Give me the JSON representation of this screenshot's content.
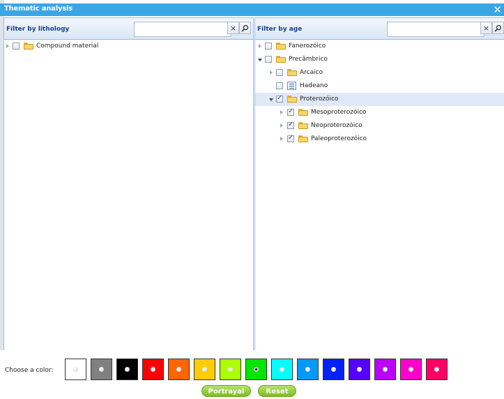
{
  "window": {
    "title": "Thematic analysis",
    "close_symbol": "✕"
  },
  "lithology": {
    "title": "Filter by lithology",
    "search_value": "",
    "clear_symbol": "×",
    "tree": [
      {
        "label": "Compound material",
        "expanded": false,
        "checked": false
      }
    ]
  },
  "age": {
    "title": "Filter by age",
    "search_value": "",
    "clear_symbol": "×",
    "tree": [
      {
        "label": "Fanerozóico",
        "expanded": false,
        "checked": false
      },
      {
        "label": "Precâmbrico",
        "expanded": true,
        "checked": false
      },
      {
        "label": "Arcaico",
        "expanded": false,
        "checked": false
      },
      {
        "label": "Hadeano",
        "checked": false
      },
      {
        "label": "Proterozóico",
        "expanded": true,
        "checked": true,
        "selected": true
      },
      {
        "label": "Mesoproterozóico",
        "expanded": false,
        "checked": true
      },
      {
        "label": "Neoproterozóico",
        "expanded": false,
        "checked": true
      },
      {
        "label": "Paleoproterozóico",
        "expanded": false,
        "checked": true
      }
    ]
  },
  "colors": {
    "label": "Choose a color:",
    "options": [
      "#ffffff",
      "#808080",
      "#000000",
      "#ff0000",
      "#ff6600",
      "#ffcc00",
      "#aaff00",
      "#00e600",
      "#00ffff",
      "#0099ff",
      "#0022ff",
      "#5500ff",
      "#bb00ff",
      "#ff00cc",
      "#ff0066"
    ],
    "selected_index": 7
  },
  "buttons": {
    "portrayal": "Portrayal",
    "reset": "Reset"
  }
}
